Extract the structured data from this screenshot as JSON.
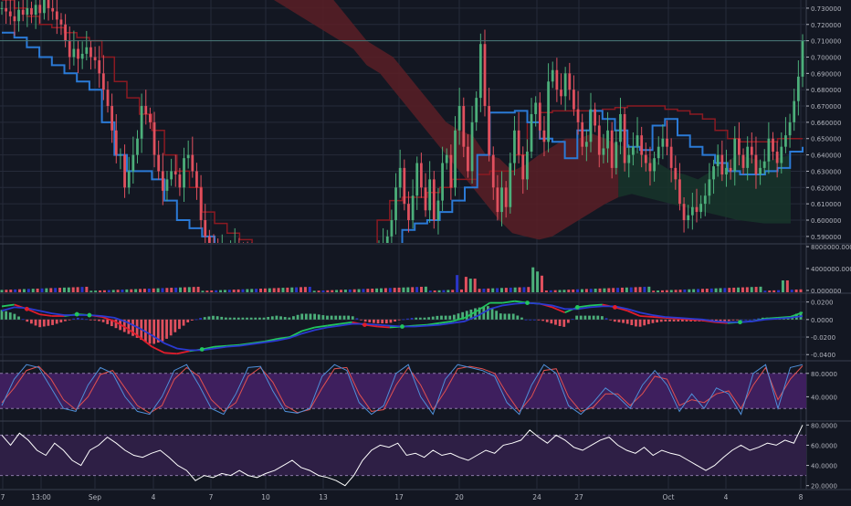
{
  "colors": {
    "background": "#131722",
    "grid": "#262b3a",
    "up": "#4caf7a",
    "down": "#e0505e",
    "axis_text": "#b2b5be",
    "separator": "#3a3f4e",
    "cloud_red": "#5a1e26",
    "cloud_green": "#17352a",
    "kijun": "#8b1a22",
    "tenkan": "#2b7ad6",
    "volume_blue": "#2a36c8",
    "macd_green": "#22c55e",
    "macd_red": "#e11d2b",
    "macd_blue": "#2a3ad0",
    "stoch_band": "#3e1f5e",
    "stoch_k": "#4f8fd8",
    "stoch_d": "#e05050",
    "rsi_band": "#2e1f45",
    "rsi_line": "#ffffff"
  },
  "chart_data": [
    {
      "type": "candlestick",
      "pane": "price",
      "x_tick_labels": [
        "7",
        "13:00",
        "Sep",
        "4",
        "7",
        "10",
        "13",
        "17",
        "20",
        "24",
        "27",
        "Oct",
        "4",
        "8"
      ],
      "y_tick_labels": [
        "0.590000",
        "0.600000",
        "0.610000",
        "0.620000",
        "0.630000",
        "0.640000",
        "0.650000",
        "0.660000",
        "0.670000",
        "0.680000",
        "0.690000",
        "0.700000",
        "0.710000",
        "0.720000",
        "0.730000"
      ],
      "ylim": [
        0.586,
        0.735
      ],
      "last_price": 0.71,
      "close_series": [
        0.73,
        0.728,
        0.725,
        0.722,
        0.729,
        0.726,
        0.73,
        0.726,
        0.732,
        0.727,
        0.735,
        0.73,
        0.728,
        0.723,
        0.72,
        0.71,
        0.7,
        0.705,
        0.699,
        0.702,
        0.706,
        0.7,
        0.698,
        0.69,
        0.68,
        0.67,
        0.655,
        0.64,
        0.64,
        0.62,
        0.63,
        0.64,
        0.65,
        0.67,
        0.665,
        0.66,
        0.64,
        0.63,
        0.618,
        0.625,
        0.63,
        0.628,
        0.62,
        0.638,
        0.64,
        0.63,
        0.62,
        0.6,
        0.59,
        0.585,
        0.58,
        0.575,
        0.58,
        0.575,
        0.58,
        0.585,
        0.58,
        0.578,
        0.575,
        0.573,
        0.57,
        0.572,
        0.57,
        0.568,
        0.57,
        0.566,
        0.565,
        0.568,
        0.57,
        0.566,
        0.562,
        0.565,
        0.56,
        0.562,
        0.555,
        0.558,
        0.56,
        0.562,
        0.565,
        0.57,
        0.568,
        0.57,
        0.572,
        0.57,
        0.575,
        0.57,
        0.568,
        0.572,
        0.575,
        0.58,
        0.585,
        0.59,
        0.6,
        0.62,
        0.632,
        0.61,
        0.6,
        0.615,
        0.635,
        0.62,
        0.606,
        0.625,
        0.6,
        0.612,
        0.635,
        0.64,
        0.62,
        0.655,
        0.67,
        0.645,
        0.63,
        0.66,
        0.675,
        0.708,
        0.67,
        0.64,
        0.62,
        0.605,
        0.62,
        0.608,
        0.635,
        0.655,
        0.64,
        0.625,
        0.642,
        0.665,
        0.672,
        0.655,
        0.648,
        0.685,
        0.692,
        0.68,
        0.676,
        0.69,
        0.68,
        0.668,
        0.66,
        0.645,
        0.648,
        0.668,
        0.658,
        0.64,
        0.644,
        0.655,
        0.632,
        0.648,
        0.665,
        0.635,
        0.64,
        0.645,
        0.652,
        0.64,
        0.635,
        0.63,
        0.638,
        0.645,
        0.65,
        0.645,
        0.632,
        0.625,
        0.61,
        0.6,
        0.603,
        0.608,
        0.605,
        0.61,
        0.615,
        0.625,
        0.633,
        0.64,
        0.628,
        0.632,
        0.63,
        0.65,
        0.64,
        0.632,
        0.645,
        0.64,
        0.628,
        0.632,
        0.636,
        0.65,
        0.642,
        0.635,
        0.645,
        0.652,
        0.66,
        0.673,
        0.688,
        0.71
      ],
      "tenkan_sen": [
        0.715,
        0.712,
        0.706,
        0.7,
        0.695,
        0.69,
        0.685,
        0.68,
        0.66,
        0.64,
        0.63,
        0.63,
        0.625,
        0.612,
        0.6,
        0.595,
        0.59,
        0.585,
        0.583,
        0.58,
        0.578,
        0.575,
        0.572,
        0.57,
        0.568,
        0.566,
        0.563,
        0.563,
        0.566,
        0.57,
        0.575,
        0.585,
        0.594,
        0.598,
        0.6,
        0.605,
        0.612,
        0.62,
        0.64,
        0.666,
        0.666,
        0.667,
        0.66,
        0.65,
        0.648,
        0.638,
        0.655,
        0.667,
        0.662,
        0.655,
        0.645,
        0.643,
        0.658,
        0.662,
        0.652,
        0.645,
        0.64,
        0.635,
        0.63,
        0.628,
        0.628,
        0.63,
        0.632,
        0.642,
        0.645
      ],
      "kijun_sen": [
        0.735,
        0.73,
        0.725,
        0.72,
        0.718,
        0.715,
        0.712,
        0.71,
        0.7,
        0.685,
        0.675,
        0.665,
        0.655,
        0.64,
        0.63,
        0.62,
        0.605,
        0.598,
        0.592,
        0.588,
        0.585,
        0.582,
        0.58,
        0.578,
        0.576,
        0.575,
        0.575,
        0.575,
        0.578,
        0.585,
        0.6,
        0.612,
        0.614,
        0.614,
        0.617,
        0.62,
        0.625,
        0.625,
        0.628,
        0.63,
        0.63,
        0.64,
        0.66,
        0.666,
        0.667,
        0.667,
        0.667,
        0.667,
        0.668,
        0.669,
        0.67,
        0.67,
        0.67,
        0.668,
        0.667,
        0.665,
        0.662,
        0.655,
        0.65,
        0.648,
        0.648,
        0.648,
        0.65,
        0.65,
        0.65
      ],
      "cloud_top": [
        0.74,
        0.74,
        0.74,
        0.74,
        0.74,
        0.73,
        0.72,
        0.71,
        0.705,
        0.7,
        0.69,
        0.68,
        0.67,
        0.66,
        0.655,
        0.652,
        0.64,
        0.638,
        0.63,
        0.634,
        0.64,
        0.645,
        0.65,
        0.65,
        0.653,
        0.65,
        0.646,
        0.644,
        0.64,
        0.635,
        0.63,
        0.628,
        0.625,
        0.63,
        0.635,
        0.64,
        0.638,
        0.636,
        0.638,
        0.64
      ],
      "cloud_bottom": [
        0.735,
        0.73,
        0.725,
        0.72,
        0.715,
        0.71,
        0.705,
        0.695,
        0.69,
        0.68,
        0.67,
        0.66,
        0.65,
        0.64,
        0.63,
        0.62,
        0.61,
        0.6,
        0.592,
        0.59,
        0.588,
        0.59,
        0.595,
        0.6,
        0.605,
        0.61,
        0.614,
        0.616,
        0.614,
        0.612,
        0.61,
        0.608,
        0.606,
        0.604,
        0.602,
        0.6,
        0.599,
        0.598,
        0.598,
        0.598
      ],
      "series": [
        {
          "name": "",
          "role": "candles"
        },
        {
          "name": "",
          "role": "tenkan"
        },
        {
          "name": "",
          "role": "kijun"
        },
        {
          "name": "",
          "role": "cloud"
        }
      ]
    },
    {
      "type": "bar",
      "pane": "volume",
      "y_tick_labels": [
        "0.000000",
        "4000000.0000",
        "8000000.0000"
      ],
      "ylim": [
        0,
        8000000
      ],
      "spikes": [
        {
          "x_fraction": 0.57,
          "value": 2900000
        },
        {
          "x_fraction": 0.58,
          "value": 2600000
        },
        {
          "x_fraction": 0.59,
          "value": 2300000
        },
        {
          "x_fraction": 0.665,
          "value": 4200000
        },
        {
          "x_fraction": 0.67,
          "value": 3500000
        },
        {
          "x_fraction": 0.675,
          "value": 2800000
        },
        {
          "x_fraction": 0.98,
          "value": 2000000
        }
      ]
    },
    {
      "type": "line",
      "pane": "macd",
      "y_tick_labels": [
        "0.0200",
        "0.0000",
        "-0.0200",
        "-0.0400"
      ],
      "ylim": [
        -0.046,
        0.029
      ],
      "macd_line": [
        0.015,
        0.017,
        0.012,
        0.006,
        0.004,
        0.004,
        0.006,
        0.005,
        0.003,
        -0.002,
        -0.01,
        -0.02,
        -0.031,
        -0.038,
        -0.039,
        -0.036,
        -0.034,
        -0.031,
        -0.03,
        -0.029,
        -0.027,
        -0.025,
        -0.022,
        -0.02,
        -0.013,
        -0.009,
        -0.007,
        -0.005,
        -0.003,
        -0.006,
        -0.008,
        -0.009,
        -0.008,
        -0.007,
        -0.006,
        -0.004,
        -0.002,
        0.002,
        0.01,
        0.019,
        0.019,
        0.021,
        0.019,
        0.018,
        0.014,
        0.008,
        0.014,
        0.016,
        0.017,
        0.014,
        0.01,
        0.004,
        0.003,
        0.002,
        0.001,
        0,
        -0.001,
        -0.003,
        -0.004,
        -0.003,
        -0.002,
        0.001,
        0.002,
        0.003,
        0.008
      ],
      "signal_line": [
        0.01,
        0.014,
        0.013,
        0.01,
        0.007,
        0.005,
        0.005,
        0.005,
        0.004,
        0.002,
        -0.003,
        -0.01,
        -0.018,
        -0.027,
        -0.033,
        -0.035,
        -0.035,
        -0.033,
        -0.031,
        -0.03,
        -0.028,
        -0.026,
        -0.024,
        -0.021,
        -0.016,
        -0.012,
        -0.009,
        -0.007,
        -0.005,
        -0.005,
        -0.006,
        -0.007,
        -0.008,
        -0.008,
        -0.007,
        -0.006,
        -0.004,
        -0.002,
        0.004,
        0.012,
        0.016,
        0.018,
        0.019,
        0.018,
        0.016,
        0.012,
        0.012,
        0.014,
        0.015,
        0.015,
        0.012,
        0.008,
        0.005,
        0.003,
        0.002,
        0.001,
        0,
        -0.002,
        -0.003,
        -0.003,
        -0.002,
        0,
        0.001,
        0.002,
        0.004
      ]
    },
    {
      "type": "line",
      "pane": "stochastic",
      "y_tick_labels": [
        "80.0000",
        "40.0000"
      ],
      "ylim": [
        0,
        100
      ],
      "band": [
        20,
        80
      ],
      "k_line": [
        25,
        70,
        95,
        90,
        55,
        20,
        15,
        60,
        90,
        80,
        40,
        15,
        10,
        40,
        85,
        95,
        60,
        20,
        10,
        45,
        90,
        92,
        50,
        15,
        12,
        20,
        75,
        95,
        85,
        30,
        10,
        25,
        80,
        95,
        40,
        10,
        70,
        95,
        90,
        85,
        75,
        30,
        10,
        60,
        95,
        80,
        25,
        10,
        30,
        55,
        40,
        20,
        60,
        85,
        60,
        15,
        45,
        20,
        55,
        45,
        10,
        80,
        95,
        20,
        90,
        95
      ],
      "d_line": [
        30,
        55,
        85,
        92,
        70,
        35,
        18,
        40,
        78,
        85,
        55,
        25,
        12,
        25,
        70,
        90,
        75,
        35,
        15,
        30,
        75,
        90,
        65,
        25,
        13,
        18,
        55,
        88,
        90,
        45,
        15,
        18,
        60,
        90,
        60,
        18,
        50,
        88,
        92,
        88,
        80,
        45,
        15,
        40,
        85,
        88,
        40,
        15,
        22,
        45,
        45,
        25,
        45,
        75,
        70,
        25,
        35,
        30,
        45,
        50,
        20,
        60,
        90,
        35,
        70,
        93
      ]
    },
    {
      "type": "line",
      "pane": "rsi",
      "y_tick_labels": [
        "80.0000",
        "60.0000",
        "40.0000",
        "20.0000"
      ],
      "ylim": [
        17,
        83
      ],
      "band": [
        30,
        70
      ],
      "rsi_line": [
        70,
        60,
        72,
        65,
        55,
        50,
        62,
        55,
        45,
        40,
        55,
        60,
        68,
        62,
        55,
        50,
        48,
        52,
        55,
        48,
        40,
        35,
        25,
        30,
        28,
        32,
        30,
        35,
        30,
        28,
        32,
        35,
        40,
        45,
        38,
        35,
        30,
        28,
        25,
        20,
        30,
        45,
        55,
        60,
        58,
        62,
        50,
        52,
        48,
        55,
        50,
        52,
        48,
        45,
        50,
        55,
        52,
        60,
        62,
        65,
        75,
        68,
        62,
        70,
        65,
        58,
        55,
        60,
        65,
        68,
        60,
        55,
        52,
        58,
        50,
        55,
        52,
        50,
        45,
        40,
        35,
        40,
        48,
        55,
        60,
        55,
        58,
        62,
        60,
        65,
        62,
        80
      ]
    }
  ]
}
